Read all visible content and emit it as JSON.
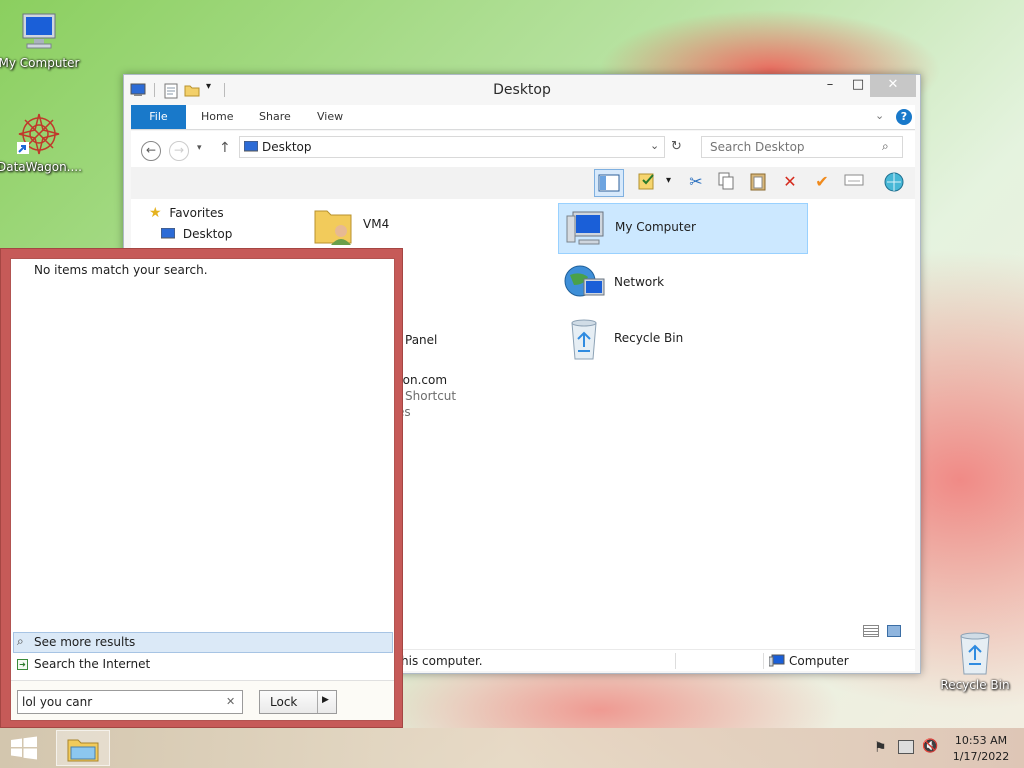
{
  "desktop": {
    "icons": [
      {
        "label": "My Computer",
        "icon": "my-computer-icon"
      },
      {
        "label": "DataWagon....",
        "icon": "datawagon-icon"
      },
      {
        "label": "Recycle Bin",
        "icon": "recycle-bin-icon"
      }
    ]
  },
  "window": {
    "title": "Desktop",
    "controls": {
      "minimize": "–",
      "maximize": "□",
      "close": "✕"
    },
    "ribbon_tabs": [
      "File",
      "Home",
      "Share",
      "View"
    ],
    "address": "Desktop",
    "search_placeholder": "Search Desktop",
    "nav": {
      "favorites": "Favorites",
      "desktop": "Desktop"
    },
    "items": [
      {
        "name": "VM4",
        "icon": "user-folder-icon"
      },
      {
        "name": "My Computer",
        "icon": "computer-icon",
        "selected": true
      },
      {
        "name": "Network",
        "icon": "network-icon"
      },
      {
        "name": "Recycle Bin",
        "icon": "recycle-bin-icon"
      }
    ],
    "partial_text": [
      "s",
      "Panel",
      "gon.com",
      "Shortcut",
      "es"
    ],
    "status": {
      "left": "his computer.",
      "right": "Computer"
    }
  },
  "search_panel": {
    "no_results": "No items match your search.",
    "see_more": "See more results",
    "search_internet": "Search the Internet",
    "query": "lol you canr",
    "lock_label": "Lock"
  },
  "taskbar": {
    "time": "10:53 AM",
    "date": "1/17/2022"
  },
  "colors": {
    "accent": "#1979ca",
    "search_panel_border": "#c65a58",
    "selection": "#cce8ff"
  }
}
